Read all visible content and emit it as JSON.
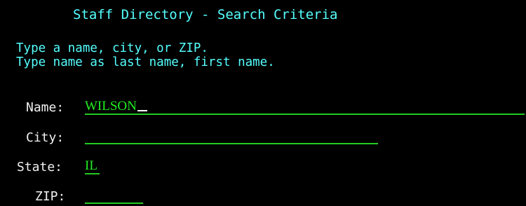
{
  "screen": {
    "title": "Staff Directory - Search Criteria",
    "instructions": [
      "Type a name, city, or ZIP.",
      "Type name as last name, first name."
    ]
  },
  "form": {
    "name": {
      "label": "Name:",
      "value": "WILSON"
    },
    "city": {
      "label": "City:",
      "value": ""
    },
    "state": {
      "label": "State:",
      "value": "IL"
    },
    "zip": {
      "label": "ZIP:",
      "value": ""
    }
  },
  "colors": {
    "background": "#000000",
    "title_text": "#55ffff",
    "label_text": "#f0f0f0",
    "field_text": "#22ee22",
    "field_underline": "#22cc22"
  }
}
